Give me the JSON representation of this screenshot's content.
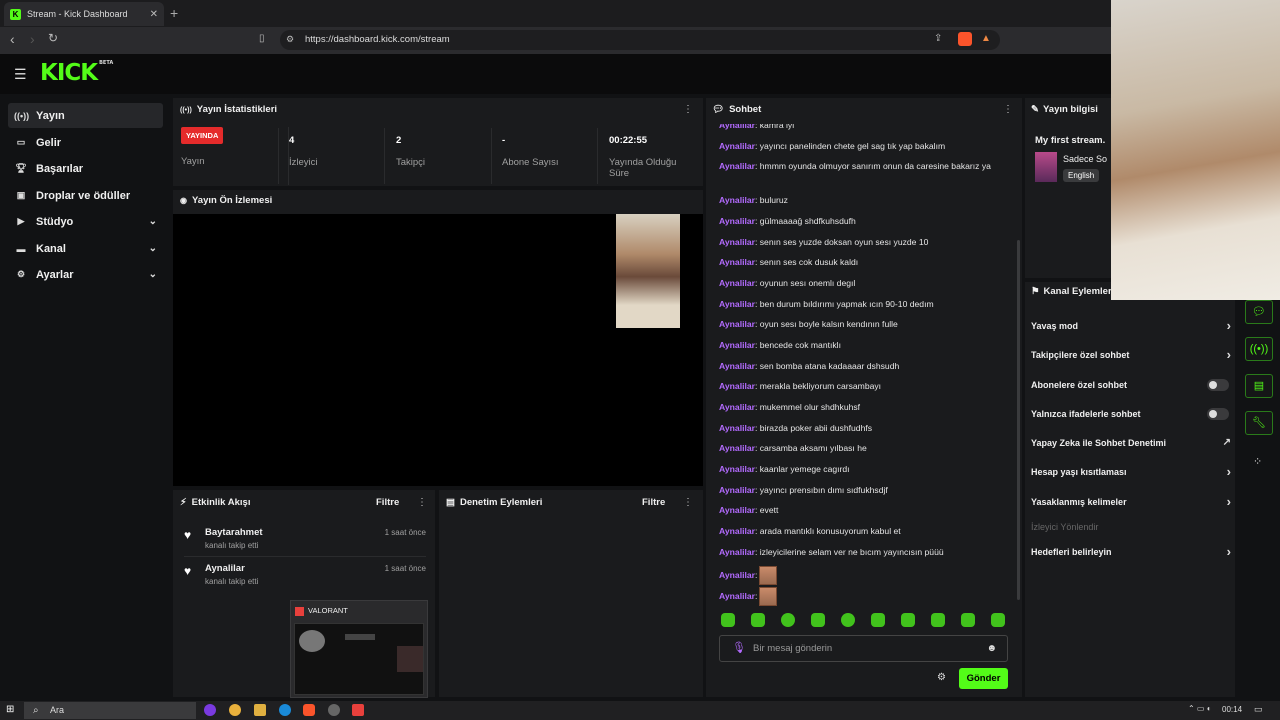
{
  "browser": {
    "tab_title": "Stream - Kick Dashboard",
    "url": "https://dashboard.kick.com/stream"
  },
  "kick": {
    "logo": "KICK",
    "logo_badge": "BETA"
  },
  "sidebar": {
    "items": [
      {
        "icon": "broadcast-icon",
        "label": "Yayın"
      },
      {
        "icon": "money-icon",
        "label": "Gelir"
      },
      {
        "icon": "trophy-icon",
        "label": "Başarılar"
      },
      {
        "icon": "gift-icon",
        "label": "Droplar ve ödüller"
      },
      {
        "icon": "video-icon",
        "label": "Stüdyo"
      },
      {
        "icon": "channel-icon",
        "label": "Kanal"
      },
      {
        "icon": "gear-icon",
        "label": "Ayarlar"
      }
    ]
  },
  "stats": {
    "title": "Yayın İstatistikleri",
    "live_badge": "YAYINDA",
    "live_label": "Yayın",
    "viewers": "4",
    "viewers_label": "İzleyici",
    "followers": "2",
    "followers_label": "Takipçi",
    "subs": "-",
    "subs_label": "Abone Sayısı",
    "uptime": "00:22:55",
    "uptime_label": "Yayında Olduğu Süre"
  },
  "preview": {
    "title": "Yayın Ön İzlemesi"
  },
  "activity": {
    "title": "Etkinlik Akışı",
    "filter": "Filtre",
    "events": [
      {
        "name": "Baytarahmet",
        "sub": "kanalı takip etti",
        "time": "1 saat önce"
      },
      {
        "name": "Aynalilar",
        "sub": "kanalı takip etti",
        "time": "1 saat önce"
      }
    ]
  },
  "moderation": {
    "title": "Denetim Eylemleri",
    "filter": "Filtre"
  },
  "chat": {
    "title": "Sohbet",
    "messages": [
      {
        "user": "Aynalilar",
        "text": ": kamra iyi"
      },
      {
        "user": "Aynalilar",
        "text": ": yayıncı panelinden chete gel sag tık yap bakalım"
      },
      {
        "user": "Aynalilar",
        "text": ": hmmm oyunda olmuyor sanırım onun da caresine bakarız ya"
      },
      {
        "user": "Aynalilar",
        "text": ": buluruz"
      },
      {
        "user": "Aynalilar",
        "text": ": gülmaaaağ shdfkuhsdufh"
      },
      {
        "user": "Aynalilar",
        "text": ": senın ses yuzde doksan oyun sesı yuzde 10"
      },
      {
        "user": "Aynalilar",
        "text": ": senın ses cok dusuk kaldı"
      },
      {
        "user": "Aynalilar",
        "text": ": oyunun sesı onemlı degıl"
      },
      {
        "user": "Aynalilar",
        "text": ": ben durum bıldırımı yapmak ıcın 90-10 dedım"
      },
      {
        "user": "Aynalilar",
        "text": ": oyun sesı boyle kalsın kendının fulle"
      },
      {
        "user": "Aynalilar",
        "text": ": bencede cok mantıklı"
      },
      {
        "user": "Aynalilar",
        "text": ": sen bomba atana kadaaaar dshsudh"
      },
      {
        "user": "Aynalilar",
        "text": ": merakla bekliyorum carsambayı"
      },
      {
        "user": "Aynalilar",
        "text": ": mukemmel olur shdhkuhsf"
      },
      {
        "user": "Aynalilar",
        "text": ": birazda poker abii dushfudhfs"
      },
      {
        "user": "Aynalilar",
        "text": ": carsamba aksamı yılbası he"
      },
      {
        "user": "Aynalilar",
        "text": ": kaanlar yemege cagırdı"
      },
      {
        "user": "Aynalilar",
        "text": ": yayıncı prensıbın dımı sıdfukhsdjf"
      },
      {
        "user": "Aynalilar",
        "text": ": evett"
      },
      {
        "user": "Aynalilar",
        "text": ": arada mantıklı konusuyorum kabul et"
      },
      {
        "user": "Aynalilar",
        "text": ": izleyicilerine selam ver ne bıcım yayıncısın püüü"
      },
      {
        "user": "Aynalilar",
        "text": ":"
      },
      {
        "user": "Aynalilar",
        "text": ":"
      }
    ],
    "input_placeholder": "Bir mesaj gönderin",
    "send": "Gönder"
  },
  "stream_info": {
    "title": "Yayın bilgisi",
    "stream_title": "My first stream.",
    "category": "Sadece So",
    "language": "English"
  },
  "channel_actions": {
    "title": "Kanal Eylemler",
    "rows": [
      {
        "label": "Yavaş mod",
        "control": "chevron"
      },
      {
        "label": "Takipçilere özel sohbet",
        "control": "chevron"
      },
      {
        "label": "Abonelere özel sohbet",
        "control": "toggle"
      },
      {
        "label": "Yalnızca ifadelerle sohbet",
        "control": "toggle"
      },
      {
        "label": "Yapay Zeka ile Sohbet Denetimi",
        "control": "external"
      },
      {
        "label": "Hesap yaşı kısıtlaması",
        "control": "chevron"
      },
      {
        "label": "Yasaklanmış kelimeler",
        "control": "chevron"
      },
      {
        "label": "İzleyici Yönlendir",
        "control": "none"
      },
      {
        "label": "Hedefleri belirleyin",
        "control": "chevron"
      }
    ]
  },
  "popup": {
    "title": "VALORANT"
  },
  "taskbar": {
    "search": "Ara",
    "time": "00:14"
  }
}
